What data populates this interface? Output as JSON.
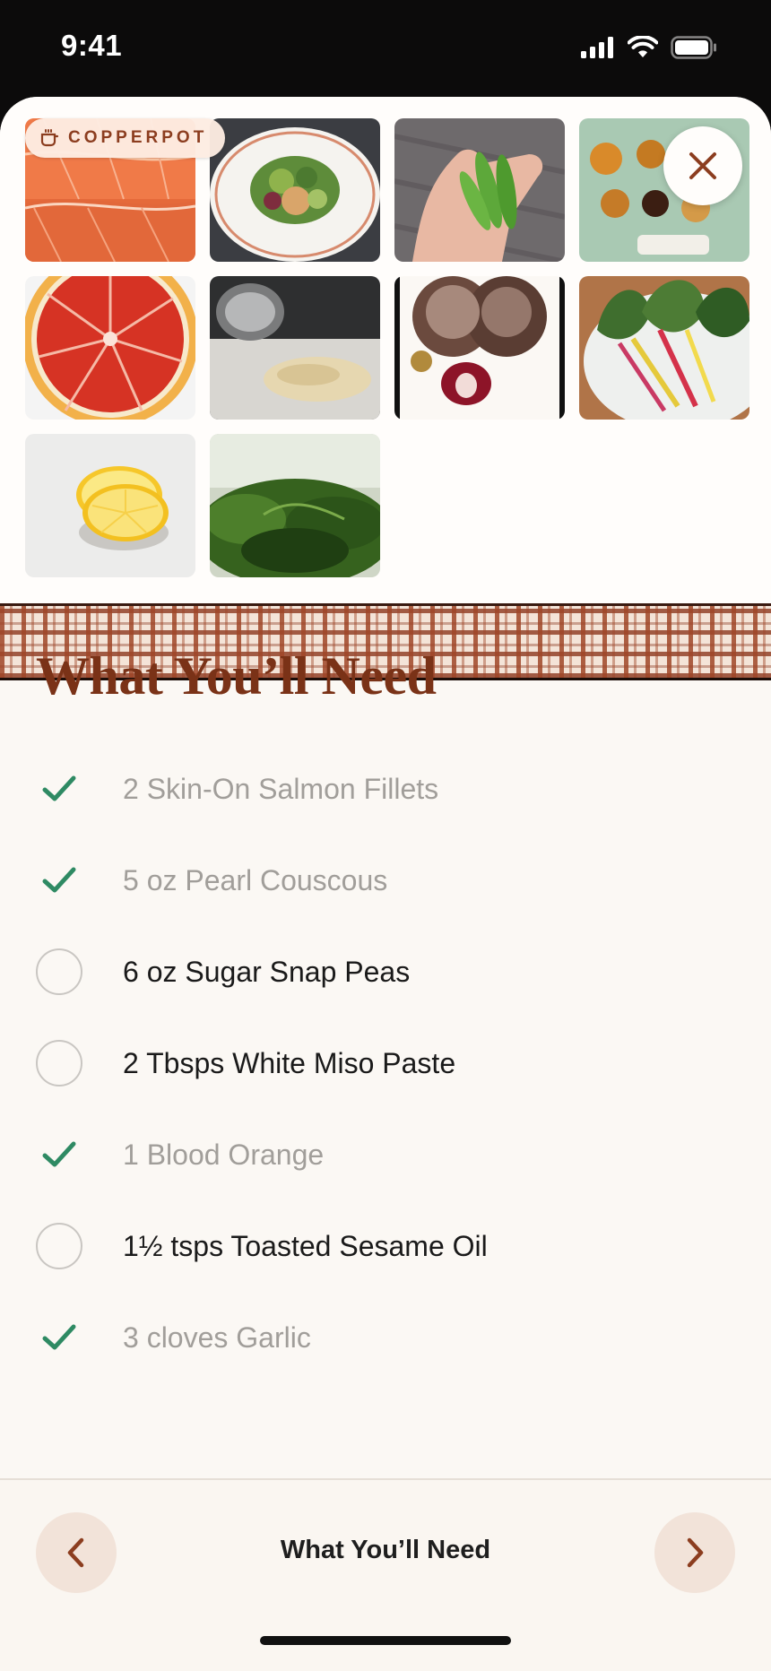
{
  "status_bar": {
    "time": "9:41"
  },
  "brand": {
    "name": "COPPERPOT"
  },
  "gallery": {
    "photos": [
      "salmon",
      "salad",
      "snap-peas",
      "miso",
      "blood-orange",
      "sesame",
      "garlic",
      "chard",
      "lemon",
      "herbs"
    ]
  },
  "section": {
    "title": "What You’ll Need"
  },
  "ingredients": [
    {
      "label": "2 Skin-On Salmon Fillets",
      "checked": true
    },
    {
      "label": "5 oz Pearl Couscous",
      "checked": true
    },
    {
      "label": "6 oz Sugar Snap Peas",
      "checked": false
    },
    {
      "label": "2 Tbsps White Miso Paste",
      "checked": false
    },
    {
      "label": "1 Blood Orange",
      "checked": true
    },
    {
      "label": "1½ tsps Toasted Sesame Oil",
      "checked": false
    },
    {
      "label": "3 cloves Garlic",
      "checked": true
    }
  ],
  "footer": {
    "title": "What You’ll Need"
  },
  "colors": {
    "accent": "#7a3217",
    "check": "#2e8a63",
    "done_text": "#a19e9a"
  }
}
